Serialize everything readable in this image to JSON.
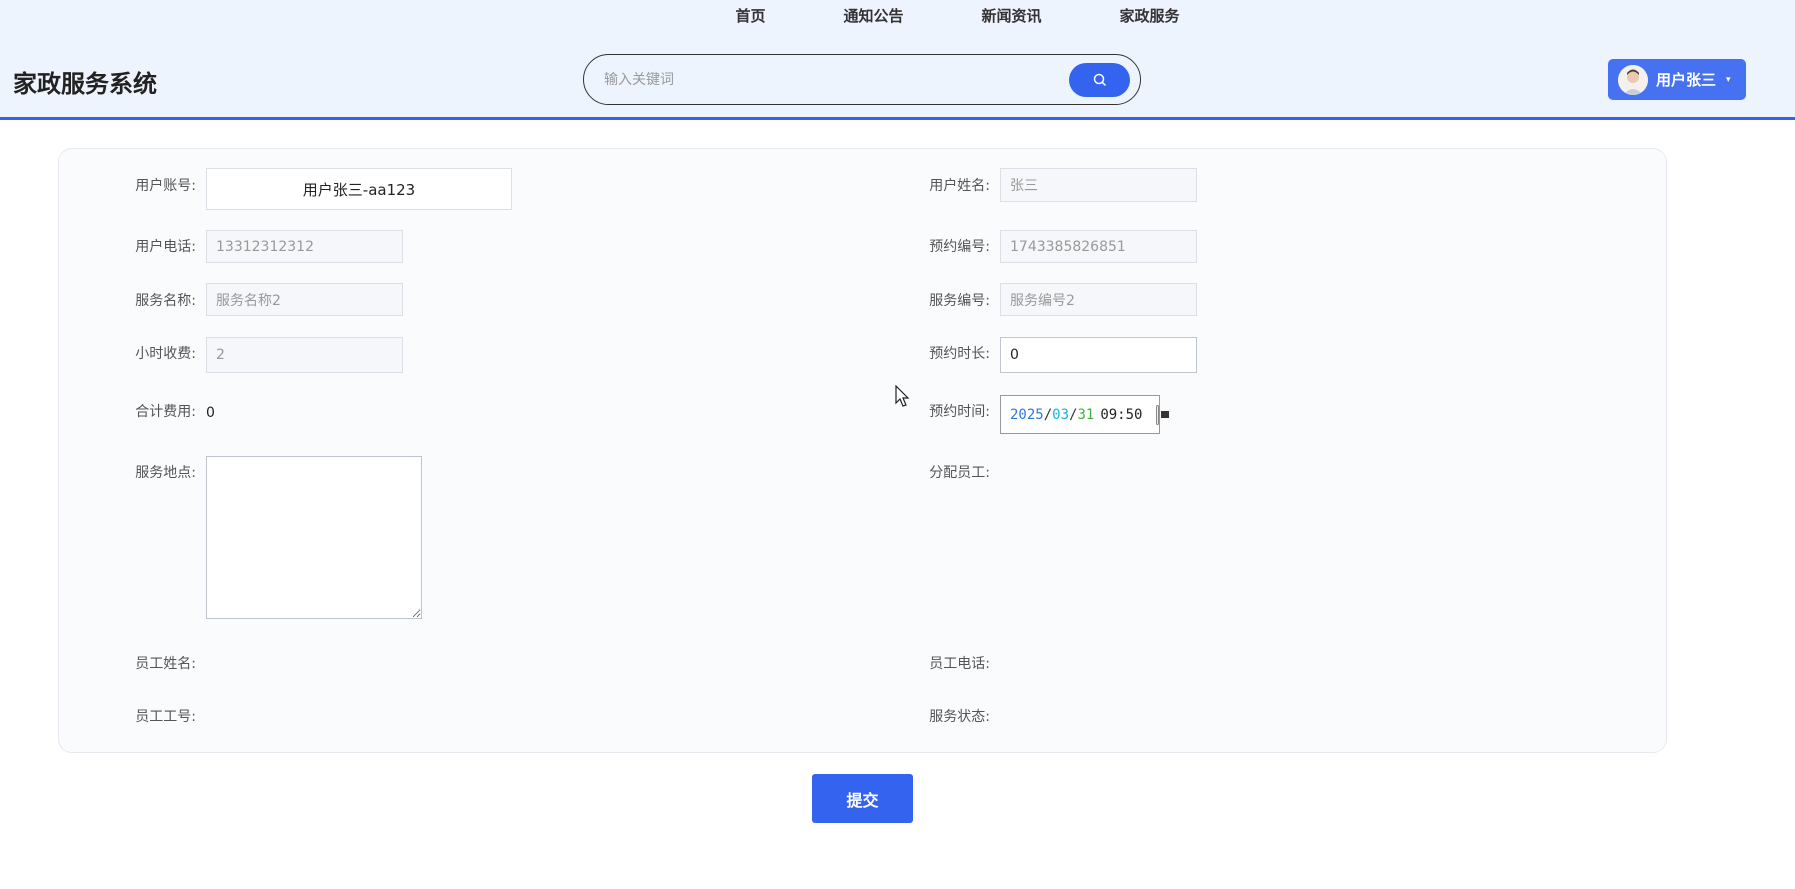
{
  "nav": {
    "items": [
      "首页",
      "通知公告",
      "新闻资讯",
      "家政服务"
    ]
  },
  "header": {
    "brand": "家政服务系统",
    "search_placeholder": "输入关键词",
    "user_label": "用户张三"
  },
  "form": {
    "account_label": "用户账号:",
    "account_value": "用户张三-aa123",
    "name_label": "用户姓名:",
    "name_value": "张三",
    "phone_label": "用户电话:",
    "phone_value": "13312312312",
    "order_no_label": "预约编号:",
    "order_no_value": "1743385826851",
    "service_name_label": "服务名称:",
    "service_name_value": "服务名称2",
    "service_no_label": "服务编号:",
    "service_no_value": "服务编号2",
    "hourly_fee_label": "小时收费:",
    "hourly_fee_value": "2",
    "duration_label": "预约时长:",
    "duration_value": "0",
    "total_label": "合计费用:",
    "total_value": "0",
    "time_label": "预约时间:",
    "time_year": "2025",
    "time_month": "03",
    "time_day": "31",
    "time_clock": "09:50",
    "location_label": "服务地点:",
    "assign_label": "分配员工:",
    "staff_name_label": "员工姓名:",
    "staff_phone_label": "员工电话:",
    "staff_no_label": "员工工号:",
    "status_label": "服务状态:"
  },
  "actions": {
    "submit": "提交"
  },
  "colors": {
    "primary": "#3463f0",
    "header_bg": "#edf4fe",
    "header_border": "#3a5ee8"
  }
}
